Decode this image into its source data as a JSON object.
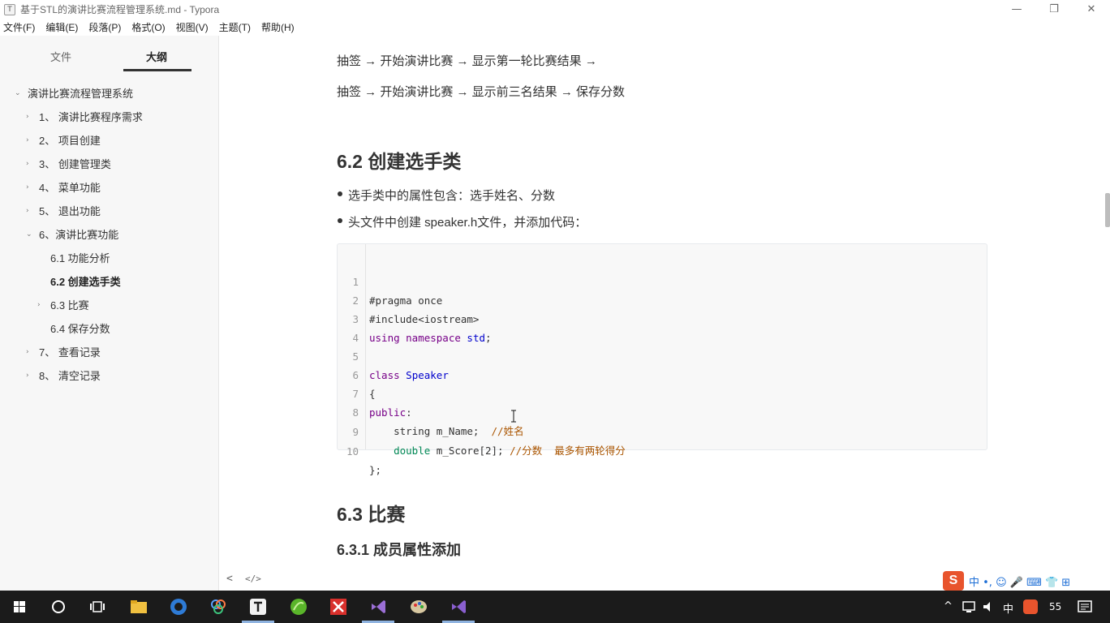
{
  "window": {
    "title": "基于STL的演讲比赛流程管理系统.md - Typora",
    "app_icon": "T",
    "minimize": "—",
    "restore": "❐",
    "close": "✕"
  },
  "menubar": [
    "文件(F)",
    "编辑(E)",
    "段落(P)",
    "格式(O)",
    "视图(V)",
    "主题(T)",
    "帮助(H)"
  ],
  "sidebar": {
    "tabs": [
      {
        "label": "文件",
        "active": false
      },
      {
        "label": "大纲",
        "active": true
      }
    ],
    "outline": [
      {
        "label": "演讲比赛流程管理系统",
        "chev": "⌄"
      },
      {
        "label": "1、 演讲比赛程序需求",
        "chev": "›"
      },
      {
        "label": "2、 项目创建",
        "chev": "›"
      },
      {
        "label": "3、 创建管理类",
        "chev": "›"
      },
      {
        "label": "4、 菜单功能",
        "chev": "›"
      },
      {
        "label": "5、 退出功能",
        "chev": "›"
      },
      {
        "label": "6、演讲比赛功能",
        "chev": "⌄"
      },
      {
        "label": "6.1 功能分析",
        "chev": ""
      },
      {
        "label": "6.2 创建选手类",
        "chev": ""
      },
      {
        "label": "6.3 比赛",
        "chev": "›"
      },
      {
        "label": "6.4 保存分数",
        "chev": ""
      },
      {
        "label": "7、 查看记录",
        "chev": "›"
      },
      {
        "label": "8、 清空记录",
        "chev": "›"
      }
    ]
  },
  "content": {
    "flow1": "抽签 → 开始演讲比赛 → 显示第一轮比赛结果 →",
    "flow2": "抽签 → 开始演讲比赛 → 显示前三名结果 → 保存分数",
    "h_62": "6.2 创建选手类",
    "bullet1": "选手类中的属性包含：选手姓名、分数",
    "bullet2": "头文件中创建 speaker.h文件，并添加代码：",
    "h_63": "6.3 比赛",
    "h_631": "6.3.1 成员属性添加"
  },
  "code": {
    "line_numbers": [
      "1",
      "2",
      "3",
      "4",
      "5",
      "6",
      "7",
      "8",
      "9",
      "10"
    ],
    "l1": "#pragma once",
    "l2": "#include<iostream>",
    "l3_kw": "using namespace",
    "l3_def": "std",
    "l3_end": ";",
    "l5_kw": "class",
    "l5_def": "Speaker",
    "l6": "{",
    "l7_kw": "public",
    "l7_end": ":",
    "l8_code": "    string m_Name;  ",
    "l8_cm": "//姓名",
    "l9_ty": "    double",
    "l9_code": " m_Score[2]; ",
    "l9_cm": "//分数  最多有两轮得分",
    "l10": "};"
  },
  "footer": {
    "back": "<",
    "source": "</>"
  },
  "ime": {
    "logo": "S",
    "glyphs": "中 •, ☺ 🎤 ⌨ 👕 ⊞"
  },
  "taskbar": {
    "start_icon": "windows-icon",
    "tray_lang": "中",
    "tray_time": "55"
  }
}
